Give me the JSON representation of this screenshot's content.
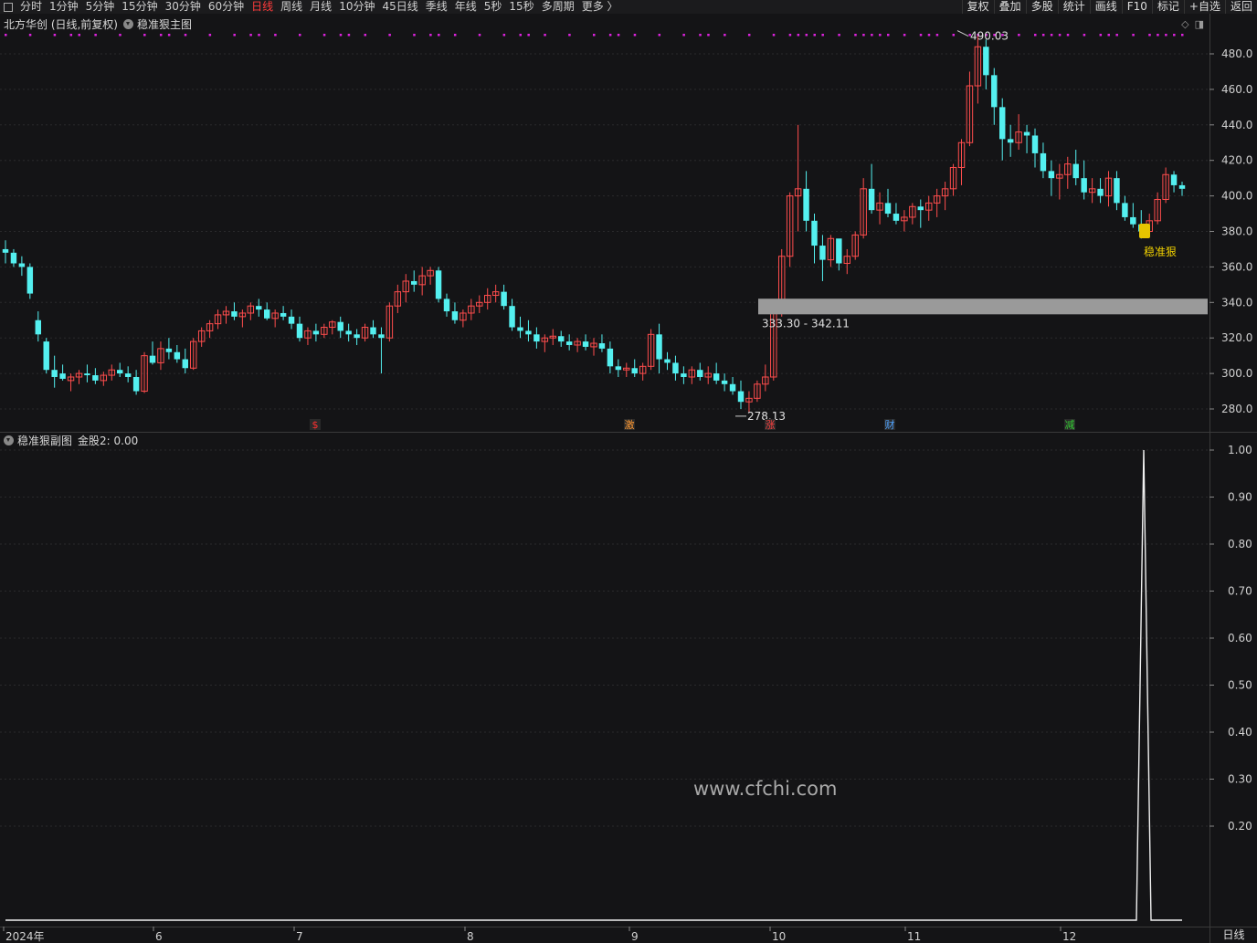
{
  "toolbar": {
    "periods": [
      "分时",
      "1分钟",
      "5分钟",
      "15分钟",
      "30分钟",
      "60分钟",
      "日线",
      "周线",
      "月线",
      "10分钟",
      "45日线",
      "季线",
      "年线",
      "5秒",
      "15秒",
      "多周期",
      "更多 〉"
    ],
    "active_period": "日线",
    "right_buttons": [
      "复权",
      "叠加",
      "多股",
      "统计",
      "画线",
      "F10",
      "标记",
      "+自选",
      "返回"
    ]
  },
  "main_chart": {
    "stock_title": "北方华创 (日线,前复权)",
    "indicator_name": "稳准狠主图",
    "y_ticks": [
      "480.0",
      "460.0",
      "440.0",
      "420.0",
      "400.0",
      "380.0",
      "360.0",
      "340.0",
      "320.0",
      "300.0",
      "280.0"
    ],
    "high_label": "490.03",
    "low_label": "278.13",
    "zone_label": "333.30 - 342.11",
    "signal_label": "稳准狠",
    "event_markers": [
      {
        "text": "$",
        "color": "#ff3030"
      },
      {
        "text": "激",
        "color": "#ff9933"
      },
      {
        "text": "涨",
        "color": "#ff4040"
      },
      {
        "text": "财",
        "color": "#4fa3ff"
      },
      {
        "text": "减",
        "color": "#33cc33"
      }
    ]
  },
  "sub_chart": {
    "indicator_name": "稳准狠副图",
    "value_label": "金股2: 0.00",
    "y_ticks": [
      "1.00",
      "0.90",
      "0.80",
      "0.70",
      "0.60",
      "0.50",
      "0.40",
      "0.30",
      "0.20"
    ]
  },
  "x_axis": {
    "labels": [
      "2024年",
      "6",
      "7",
      "8",
      "9",
      "10",
      "11",
      "12"
    ]
  },
  "watermark": "www.cfchi.com",
  "period_label": "日线",
  "colors": {
    "up": "#ff4d4d",
    "down": "#54f0f0",
    "background": "#141416",
    "zone": "#9a9a9a",
    "dots": "#dd22dd",
    "active": "#ff3b3b"
  }
}
